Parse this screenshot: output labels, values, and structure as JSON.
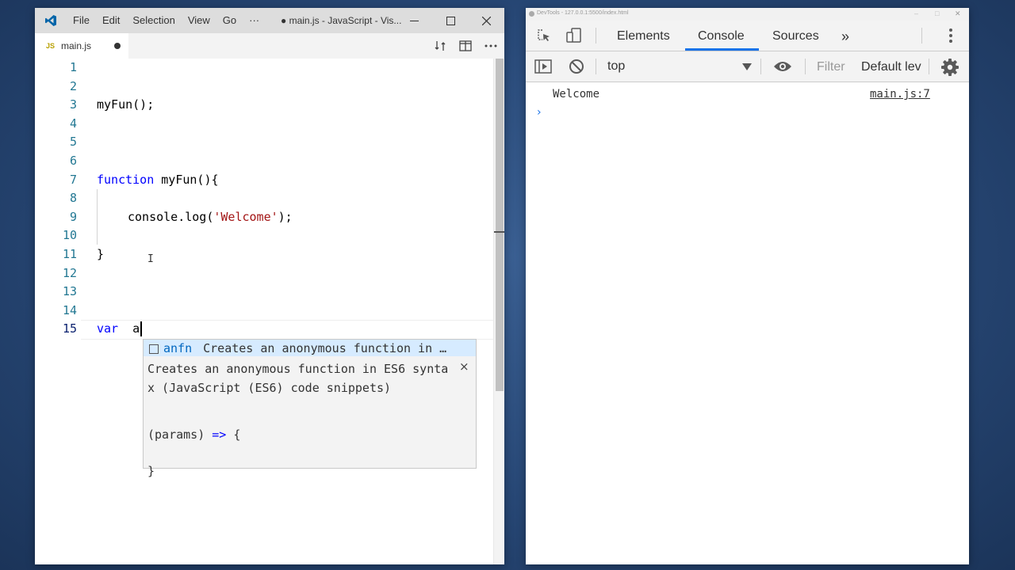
{
  "vscode": {
    "logo_icon": "vscode-logo-icon",
    "menu": [
      "File",
      "Edit",
      "Selection",
      "View",
      "Go",
      "···"
    ],
    "title": "● main.js - JavaScript - Vis...",
    "tab": {
      "badge": "JS",
      "label": "main.js",
      "modified": true
    },
    "line_numbers": [
      "1",
      "2",
      "3",
      "4",
      "5",
      "6",
      "7",
      "8",
      "9",
      "10",
      "11",
      "12",
      "13",
      "14",
      "15"
    ],
    "code": {
      "l3": "myFun();",
      "l7_kw": "function",
      "l7_rest": " myFun(){",
      "l9_pre": "console.log(",
      "l9_str": "'Welcome'",
      "l9_post": ");",
      "l11": "}",
      "l15_kw": "var",
      "l15_rest": "  a"
    },
    "suggest": {
      "name": "anfn",
      "description": "Creates an anonymous function in …",
      "detail_doc": "Creates an anonymous function in ES6 syntax (JavaScript (ES6) code snippets)",
      "close_icon": "×",
      "code_params": "(params) ",
      "code_arrow": "=>",
      "code_brace": " {",
      "code_close": "}"
    }
  },
  "devtools": {
    "title": "DevTools - 127.0.0.1:5500/index.html",
    "tabs": [
      "Elements",
      "Console",
      "Sources"
    ],
    "active_tab": "Console",
    "more_tabs": "»",
    "context": "top",
    "filter_placeholder": "Filter",
    "levels": "Default levels",
    "message": {
      "text": "Welcome",
      "source": "main.js:7"
    },
    "prompt": "›",
    "accent": "#1a73e8"
  }
}
